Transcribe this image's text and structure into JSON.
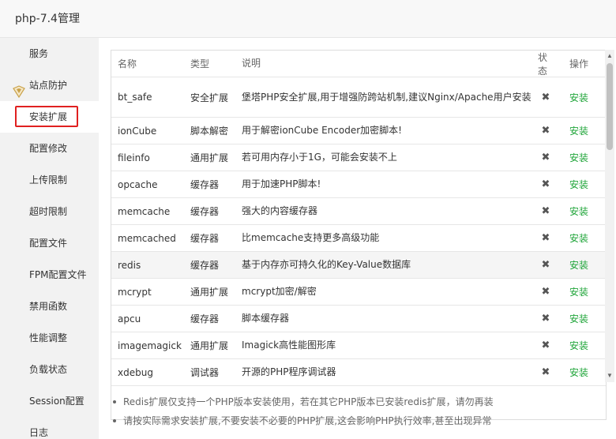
{
  "window": {
    "title": "php-7.4管理"
  },
  "sidebar": {
    "items": [
      {
        "label": "服务"
      },
      {
        "label": "站点防护",
        "icon": "shield-icon"
      },
      {
        "label": "安装扩展",
        "active": true
      },
      {
        "label": "配置修改"
      },
      {
        "label": "上传限制"
      },
      {
        "label": "超时限制"
      },
      {
        "label": "配置文件"
      },
      {
        "label": "FPM配置文件"
      },
      {
        "label": "禁用函数"
      },
      {
        "label": "性能调整"
      },
      {
        "label": "负载状态"
      },
      {
        "label": "Session配置"
      },
      {
        "label": "日志"
      }
    ]
  },
  "table": {
    "headers": {
      "name": "名称",
      "type": "类型",
      "desc": "说明",
      "status": "状态",
      "op": "操作"
    },
    "rows": [
      {
        "name": "bt_safe",
        "type": "安全扩展",
        "desc": "堡塔PHP安全扩展,用于增强防跨站机制,建议Nginx/Apache用户安装",
        "status": "✖",
        "op": "安装"
      },
      {
        "name": "ionCube",
        "type": "脚本解密",
        "desc": "用于解密ionCube Encoder加密脚本!",
        "status": "✖",
        "op": "安装"
      },
      {
        "name": "fileinfo",
        "type": "通用扩展",
        "desc": "若可用内存小于1G，可能会安装不上",
        "status": "✖",
        "op": "安装"
      },
      {
        "name": "opcache",
        "type": "缓存器",
        "desc": "用于加速PHP脚本!",
        "status": "✖",
        "op": "安装"
      },
      {
        "name": "memcache",
        "type": "缓存器",
        "desc": "强大的内容缓存器",
        "status": "✖",
        "op": "安装"
      },
      {
        "name": "memcached",
        "type": "缓存器",
        "desc": "比memcache支持更多高级功能",
        "status": "✖",
        "op": "安装"
      },
      {
        "name": "redis",
        "type": "缓存器",
        "desc": "基于内存亦可持久化的Key-Value数据库",
        "status": "✖",
        "op": "安装",
        "highlighted": true
      },
      {
        "name": "mcrypt",
        "type": "通用扩展",
        "desc": "mcrypt加密/解密",
        "status": "✖",
        "op": "安装"
      },
      {
        "name": "apcu",
        "type": "缓存器",
        "desc": "脚本缓存器",
        "status": "✖",
        "op": "安装"
      },
      {
        "name": "imagemagick",
        "type": "通用扩展",
        "desc": "Imagick高性能图形库",
        "status": "✖",
        "op": "安装"
      },
      {
        "name": "xdebug",
        "type": "调试器",
        "desc": "开源的PHP程序调试器",
        "status": "✖",
        "op": "安装"
      }
    ]
  },
  "notes": [
    "Redis扩展仅支持一个PHP版本安装使用，若在其它PHP版本已安装redis扩展，请勿再装",
    "请按实际需求安装扩展,不要安装不必要的PHP扩展,这会影响PHP执行效率,甚至出现异常"
  ],
  "colors": {
    "accent": "#20a53a",
    "active_border": "#e02020"
  }
}
